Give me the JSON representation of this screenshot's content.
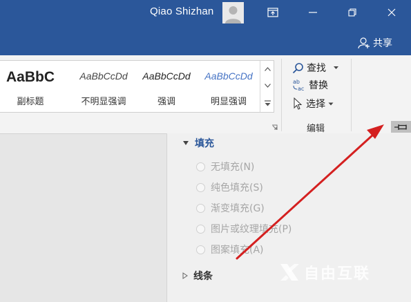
{
  "titlebar": {
    "user_name": "Qiao Shizhan",
    "share_label": "共享",
    "accent_color": "#2b579a"
  },
  "styles": {
    "items": [
      {
        "sample": "AaBbC",
        "label": "副标题"
      },
      {
        "sample": "AaBbCcDd",
        "label": "不明显强调"
      },
      {
        "sample": "AaBbCcDd",
        "label": "强调"
      },
      {
        "sample": "AaBbCcDd",
        "label": "明显强调"
      }
    ]
  },
  "editing": {
    "find_label": "查找",
    "replace_label": "替换",
    "select_label": "选择",
    "group_label": "编辑"
  },
  "pane": {
    "fill_heading": "填充",
    "fill_options": [
      {
        "label": "无填充(N)"
      },
      {
        "label": "纯色填充(S)"
      },
      {
        "label": "渐变填充(G)"
      },
      {
        "label": "图片或纹理填充(P)"
      },
      {
        "label": "图案填充(A)"
      }
    ],
    "line_heading": "线条"
  },
  "annotation": {
    "arrow_color": "#d42020"
  },
  "watermark": {
    "text": "自由互联"
  }
}
